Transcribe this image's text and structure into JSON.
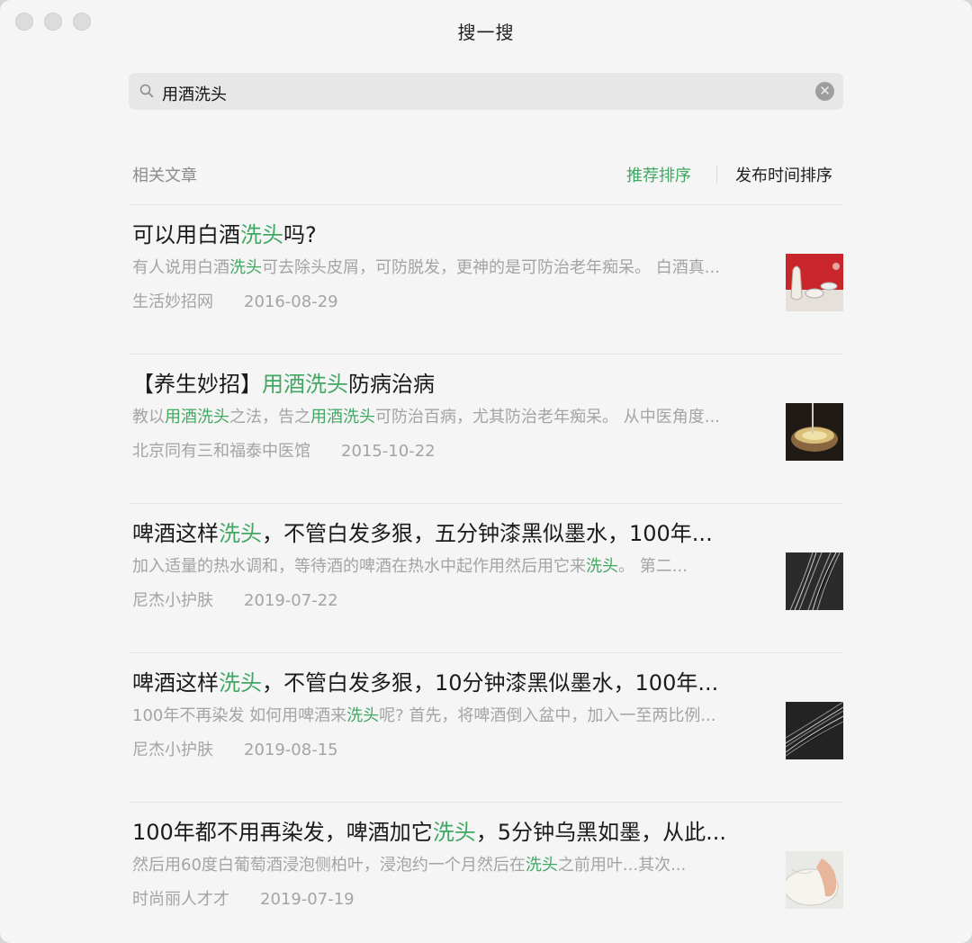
{
  "window": {
    "title": "搜一搜"
  },
  "search": {
    "query": "用酒洗头"
  },
  "results_header": {
    "label": "相关文章",
    "sort_recommended": "推荐排序",
    "sort_time": "发布时间排序"
  },
  "colors": {
    "accent": "#41a863",
    "background": "#f5f5f5"
  },
  "articles": [
    {
      "title": [
        {
          "t": "可以用白酒",
          "h": false
        },
        {
          "t": "洗头",
          "h": true
        },
        {
          "t": "吗?",
          "h": false
        }
      ],
      "desc": [
        {
          "t": "有人说用白酒",
          "h": false
        },
        {
          "t": "洗头",
          "h": true
        },
        {
          "t": "可去除头皮屑，可防脱发，更神的是可防治老年痴呆。 白酒真...",
          "h": false
        }
      ],
      "source": "生活妙招网",
      "date": "2016-08-29",
      "thumb": "white-liquor-cups"
    },
    {
      "title": [
        {
          "t": "【养生妙招】",
          "h": false
        },
        {
          "t": "用酒洗头",
          "h": true
        },
        {
          "t": "防病治病",
          "h": false
        }
      ],
      "desc": [
        {
          "t": "教以",
          "h": false
        },
        {
          "t": "用酒洗头",
          "h": true
        },
        {
          "t": "之法，告之",
          "h": false
        },
        {
          "t": "用酒洗头",
          "h": true
        },
        {
          "t": "可防治百病，尤其防治老年痴呆。 从中医角度...",
          "h": false
        }
      ],
      "source": "北京同有三和福泰中医馆",
      "date": "2015-10-22",
      "thumb": "wine-bowl"
    },
    {
      "title": [
        {
          "t": "啤酒这样",
          "h": false
        },
        {
          "t": "洗头",
          "h": true
        },
        {
          "t": "，不管白发多狠，五分钟漆黑似墨水，100年...",
          "h": false
        }
      ],
      "desc": [
        {
          "t": "加入适量的热水调和，等待酒的啤酒在热水中起作用然后用它来",
          "h": false
        },
        {
          "t": "洗头",
          "h": true
        },
        {
          "t": "。 第二...",
          "h": false
        }
      ],
      "source": "尼杰小护肤",
      "date": "2019-07-22",
      "thumb": "gray-hair"
    },
    {
      "title": [
        {
          "t": "啤酒这样",
          "h": false
        },
        {
          "t": "洗头",
          "h": true
        },
        {
          "t": "，不管白发多狠，10分钟漆黑似墨水，100年...",
          "h": false
        }
      ],
      "desc": [
        {
          "t": "100年不再染发 如何用啤酒来",
          "h": false
        },
        {
          "t": "洗头",
          "h": true
        },
        {
          "t": "呢? 首先，将啤酒倒入盆中，加入一至两比例...",
          "h": false
        }
      ],
      "source": "尼杰小护肤",
      "date": "2019-08-15",
      "thumb": "gray-hair-2"
    },
    {
      "title": [
        {
          "t": "100年都不用再染发，啤酒加它",
          "h": false
        },
        {
          "t": "洗头",
          "h": true
        },
        {
          "t": "，5分钟乌黑如墨，从此...",
          "h": false
        }
      ],
      "desc": [
        {
          "t": "然后用60度白葡萄酒浸泡侧柏叶，浸泡约一个月然后在",
          "h": false
        },
        {
          "t": "洗头",
          "h": true
        },
        {
          "t": "之前用叶...其次...",
          "h": false
        }
      ],
      "source": "时尚丽人才才",
      "date": "2019-07-19",
      "thumb": "hand-in-basin"
    }
  ]
}
